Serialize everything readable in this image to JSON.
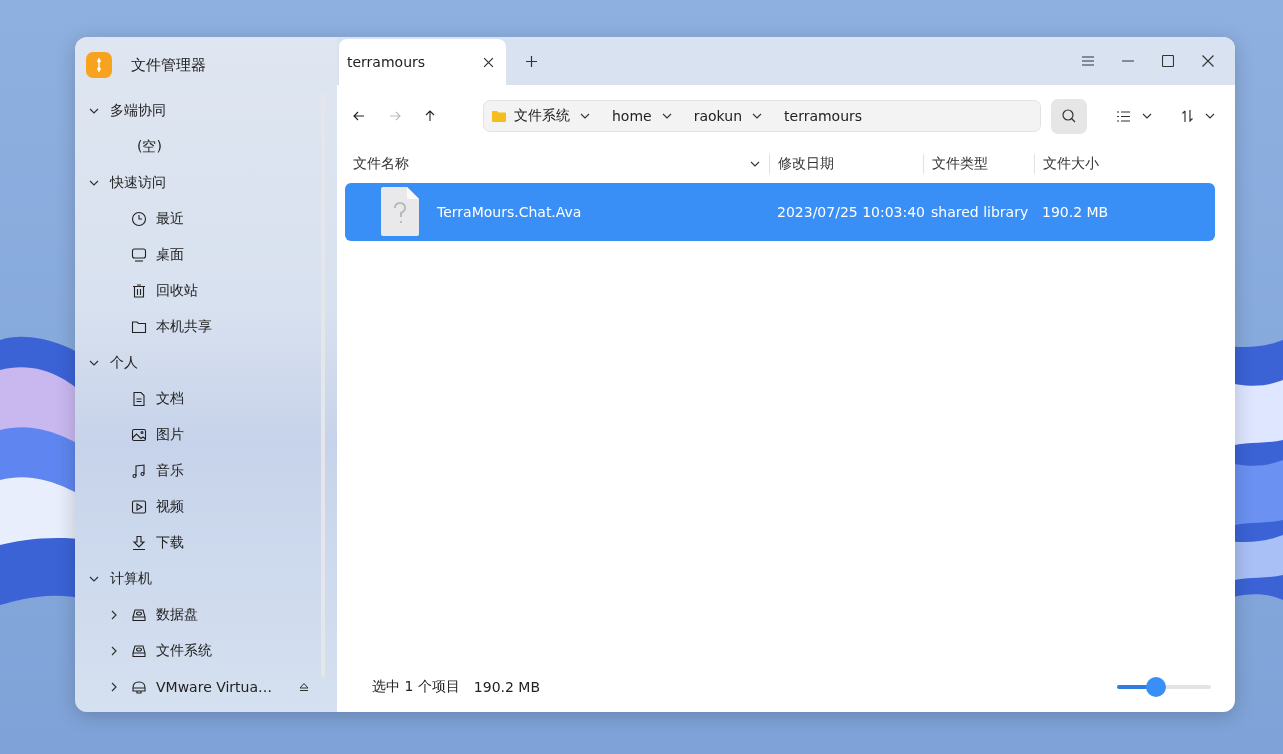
{
  "sidebar": {
    "app_title": "文件管理器",
    "groups": [
      {
        "label": "多端协同",
        "expanded": true,
        "empty_text": "(空)"
      },
      {
        "label": "快速访问",
        "expanded": true,
        "children": [
          {
            "label": "最近",
            "kind": "recent"
          },
          {
            "label": "桌面",
            "kind": "desktop"
          },
          {
            "label": "回收站",
            "kind": "trash"
          },
          {
            "label": "本机共享",
            "kind": "share"
          }
        ]
      },
      {
        "label": "个人",
        "expanded": true,
        "children": [
          {
            "label": "文档",
            "kind": "documents"
          },
          {
            "label": "图片",
            "kind": "pictures"
          },
          {
            "label": "音乐",
            "kind": "music"
          },
          {
            "label": "视频",
            "kind": "videos"
          },
          {
            "label": "下载",
            "kind": "downloads"
          }
        ]
      },
      {
        "label": "计算机",
        "expanded": true,
        "children": [
          {
            "label": "数据盘",
            "kind": "disk",
            "expanded": false
          },
          {
            "label": "文件系统",
            "kind": "disk",
            "expanded": false
          },
          {
            "label": "VMware Virtua…",
            "kind": "removable",
            "expanded": false
          }
        ]
      }
    ]
  },
  "tabs": [
    {
      "label": "terramours",
      "selected": true
    }
  ],
  "toolbar": {
    "back_disabled": false,
    "forward_disabled": true,
    "breadcrumb": [
      {
        "label": "文件系统"
      },
      {
        "label": "home"
      },
      {
        "label": "raokun"
      },
      {
        "label": "terramours"
      }
    ]
  },
  "table": {
    "columns": [
      "文件名称",
      "修改日期",
      "文件类型",
      "文件大小"
    ],
    "rows": [
      {
        "name": "TerraMours.Chat.Ava",
        "modified": "2023/07/25 10:03:40",
        "type": "shared library",
        "size": "190.2 MB",
        "selected": true
      }
    ]
  },
  "status_bar": {
    "selection": "选中 1 个项目",
    "size": "190.2 MB",
    "zoom": {
      "level": 0.41
    }
  }
}
